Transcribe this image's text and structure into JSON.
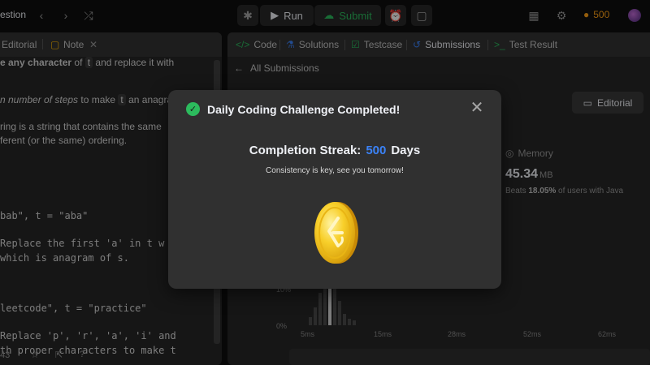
{
  "topbar": {
    "title_fragment": "estion",
    "run_label": "Run",
    "submit_label": "Submit",
    "coins": "500"
  },
  "left_panel": {
    "tabs": [
      "Editorial",
      "Note"
    ],
    "lines": [
      {
        "pre": "",
        "bold": "e any character",
        "mid": " of ",
        "code": "t",
        "post": " and replace it with"
      },
      {
        "italic": "n number of steps",
        "mid": " to make ",
        "code": "t",
        "post": " an anagram"
      },
      {
        "text": "ring is a string that contains the same"
      },
      {
        "text": "ferent (or the same) ordering."
      }
    ],
    "code_lines": [
      "bab\", t = \"aba\"",
      "Replace the first 'a' in t w",
      " which is anagram of s.",
      "leetcode\", t = \"practice\"",
      "Replace 'p', 'r', 'a', 'i' and",
      "th proper characters to make t"
    ],
    "footer_num": "43"
  },
  "right_panel": {
    "tabs": [
      "Code",
      "Solutions",
      "Testcase",
      "Submissions",
      "Test Result"
    ],
    "back_label": "All Submissions",
    "editorial_label": "Editorial",
    "memory_label": "Memory",
    "memory_value": "45.34",
    "memory_unit": "MB",
    "beats_prefix": "Beats ",
    "beats_value": "18.05%",
    "beats_suffix": " of users with Java",
    "chart_pcts": [
      "10%",
      "0%"
    ],
    "chart_ticks": [
      "5ms",
      "15ms",
      "28ms",
      "52ms",
      "62ms"
    ]
  },
  "modal": {
    "title": "Daily Coding Challenge Completed!",
    "streak_label": "Completion Streak:",
    "streak_value": "500",
    "streak_unit": "Days",
    "subtitle": "Consistency is key, see you tomorrow!"
  },
  "icons": {
    "check": "check-circle-icon",
    "close": "close-icon",
    "coin": "leetcode-coin-icon"
  },
  "colors": {
    "accent_green": "#2cbb5d",
    "accent_blue": "#3b82f6",
    "accent_orange": "#ffa116"
  }
}
